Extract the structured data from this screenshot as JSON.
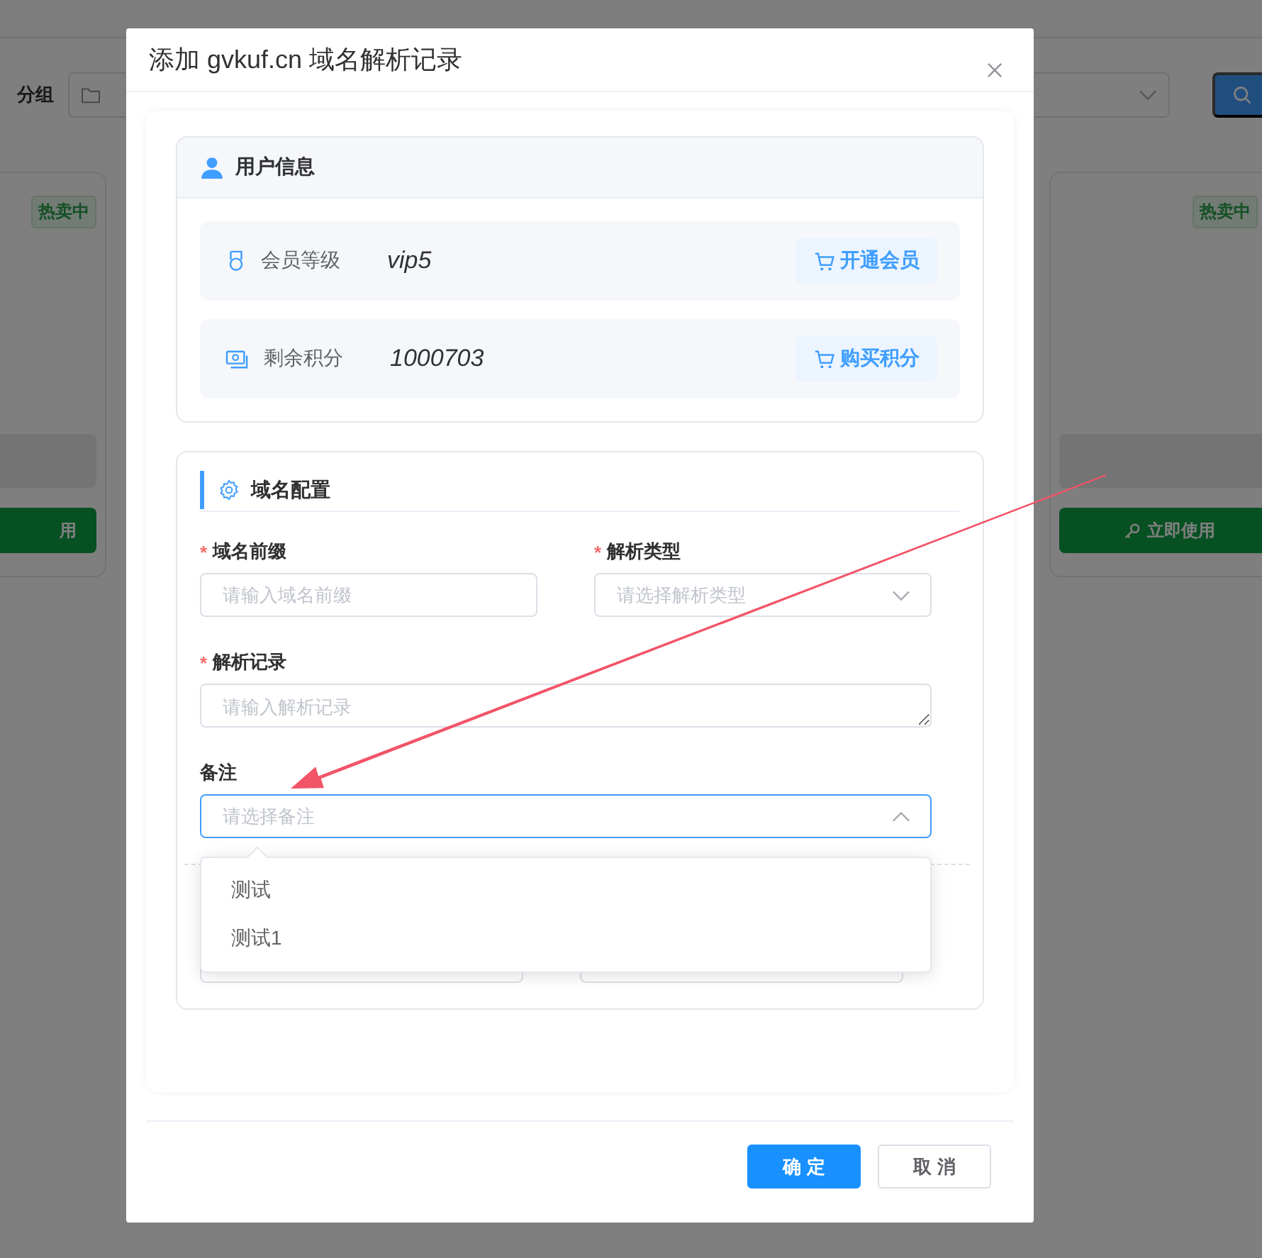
{
  "background": {
    "filter_label": "分组",
    "cards": [
      {
        "badge": "热卖中",
        "button": "用",
        "button_icon": false
      },
      {
        "badge": "热卖中",
        "button": "立即使用",
        "button_icon": true
      }
    ]
  },
  "dialog": {
    "title": "添加 gvkuf.cn 域名解析记录",
    "user_info": {
      "title": "用户信息",
      "rows": [
        {
          "kind": "level",
          "label": "会员等级",
          "value": "vip5",
          "action": "开通会员"
        },
        {
          "kind": "points",
          "label": "剩余积分",
          "value": "1000703",
          "action": "购买积分"
        }
      ]
    },
    "domain_config": {
      "title": "域名配置",
      "rows": [
        [
          {
            "kind": "input",
            "label": "域名前缀",
            "required_mark": "*",
            "placeholder": "请输入域名前缀"
          },
          {
            "kind": "select",
            "label": "解析类型",
            "required_mark": "*",
            "placeholder": "请选择解析类型",
            "open": false
          }
        ],
        [
          {
            "kind": "textarea",
            "label": "解析记录",
            "required_mark": "*",
            "placeholder": "请输入解析记录"
          }
        ],
        [
          {
            "kind": "select",
            "label": "备注",
            "placeholder": "请选择备注",
            "open": true,
            "options": [
              {
                "label": "测试",
                "selected": false
              },
              {
                "label": "测试1",
                "selected": false
              }
            ]
          }
        ],
        [
          {
            "kind": "input"
          },
          {
            "kind": "input"
          }
        ]
      ]
    },
    "buttons": [
      {
        "label": "确 定",
        "kind": "primary"
      },
      {
        "label": "取 消",
        "kind": "default"
      }
    ]
  }
}
